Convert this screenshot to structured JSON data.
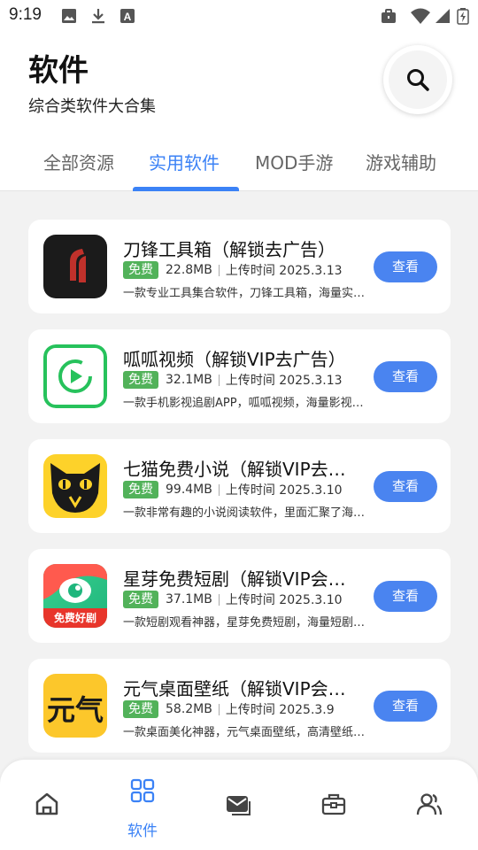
{
  "status_bar": {
    "time": "9:19",
    "icons": [
      "image-icon",
      "download-icon",
      "a-icon",
      "briefcase-icon",
      "wifi-icon",
      "signal-icon",
      "battery-icon"
    ]
  },
  "header": {
    "title": "软件",
    "subtitle": "综合类软件大合集",
    "search_icon": "search-icon"
  },
  "tabs": [
    {
      "label": "全部资源",
      "active": false
    },
    {
      "label": "实用软件",
      "active": true
    },
    {
      "label": "MOD手游",
      "active": false
    },
    {
      "label": "游戏辅助",
      "active": false
    }
  ],
  "apps": [
    {
      "name": "刀锋工具箱（解锁去广告）",
      "badge": "免费",
      "size": "22.8MB",
      "upload": "上传时间 2025.3.13",
      "desc": "一款专业工具集合软件，刀锋工具箱，海量实用工具",
      "button": "查看",
      "icon": "blade-toolbox-icon"
    },
    {
      "name": "呱呱视频（解锁VIP去广告）",
      "badge": "免费",
      "size": "32.1MB",
      "upload": "上传时间 2025.3.13",
      "desc": "一款手机影视追剧APP，呱呱视频，海量影视资源",
      "button": "查看",
      "icon": "guagua-video-icon"
    },
    {
      "name": "七猫免费小说（解锁VIP去广告）",
      "badge": "免费",
      "size": "99.4MB",
      "upload": "上传时间 2025.3.10",
      "desc": "一款非常有趣的小说阅读软件，里面汇聚了海量小说",
      "button": "查看",
      "icon": "qimao-cat-icon"
    },
    {
      "name": "星芽免费短剧（解锁VIP会员）",
      "badge": "免费",
      "size": "37.1MB",
      "upload": "上传时间 2025.3.10",
      "desc": "一款短剧观看神器，星芽免费短剧，海量短剧资源",
      "button": "查看",
      "icon": "xingya-drama-icon",
      "icon_text": "免费好剧"
    },
    {
      "name": "元气桌面壁纸（解锁VIP会员）",
      "badge": "免费",
      "size": "58.2MB",
      "upload": "上传时间 2025.3.9",
      "desc": "一款桌面美化神器，元气桌面壁纸，高清壁纸资源",
      "button": "查看",
      "icon": "yuanqi-wallpaper-icon",
      "icon_text": "元气"
    }
  ],
  "bottom_nav": [
    {
      "icon": "home-icon",
      "label": "",
      "active": false
    },
    {
      "icon": "grid-icon",
      "label": "软件",
      "active": true
    },
    {
      "icon": "mail-icon",
      "label": "",
      "active": false
    },
    {
      "icon": "toolbox-icon",
      "label": "",
      "active": false
    },
    {
      "icon": "users-icon",
      "label": "",
      "active": false
    }
  ],
  "colors": {
    "accent": "#3b82f6",
    "button": "#4a84f0",
    "free_badge": "#52b25a",
    "background": "#f2f2f2"
  }
}
